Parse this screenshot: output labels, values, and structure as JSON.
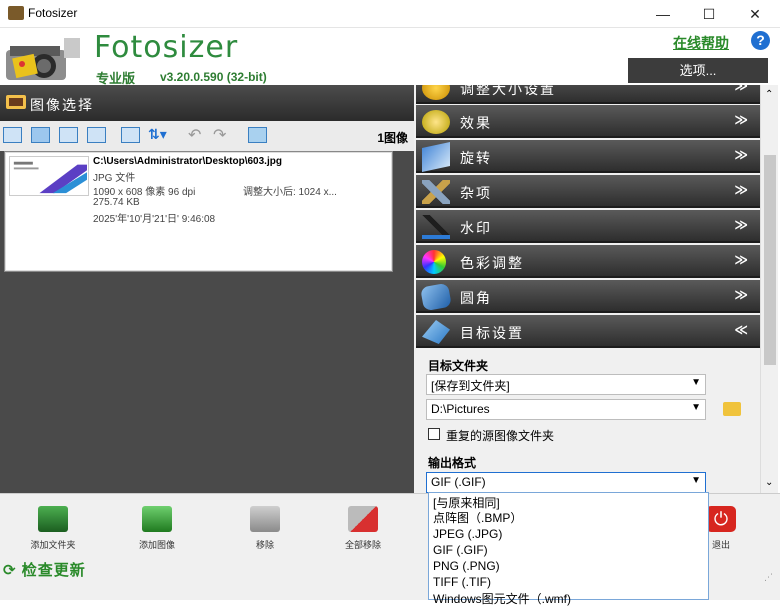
{
  "window": {
    "title": "Fotosizer",
    "minimize": "—",
    "maximize": "☐",
    "close": "✕"
  },
  "header": {
    "brand": "Fotosizer",
    "edition": "专业版",
    "version": "v3.20.0.590  (32-bit)",
    "help_link": "在线帮助",
    "help_icon": "?",
    "options_button": "选项..."
  },
  "left_panel": {
    "title": "图像选择",
    "count": "1图像",
    "file": {
      "path": "C:\\Users\\Administrator\\Desktop\\603.jpg",
      "type": "JPG 文件",
      "dims": "1090 x 608 像素 96 dpi",
      "resize_label": "调整大小后:  1024 x...",
      "size": "275.74 KB",
      "date": "2025'年'10'月'21'日' 9:46:08"
    }
  },
  "right_panel": {
    "sections": [
      {
        "label": "调整大小设置",
        "chev": "≫",
        "icon": "resize-icon"
      },
      {
        "label": "效果",
        "chev": "≫",
        "icon": "effects-icon"
      },
      {
        "label": "旋转",
        "chev": "≫",
        "icon": "rotate-icon"
      },
      {
        "label": "杂项",
        "chev": "≫",
        "icon": "tools-icon"
      },
      {
        "label": "水印",
        "chev": "≫",
        "icon": "watermark-icon"
      },
      {
        "label": "色彩调整",
        "chev": "≫",
        "icon": "color-wheel-icon"
      },
      {
        "label": "圆角",
        "chev": "≫",
        "icon": "rounded-corners-icon"
      },
      {
        "label": "目标设置",
        "chev": "≪",
        "icon": "target-icon"
      }
    ],
    "target_folder_label": "目标文件夹",
    "save_mode": "[保存到文件夹]",
    "folder_path": "D:\\Pictures",
    "checkbox_label": "重复的源图像文件夹",
    "output_format_label": "输出格式",
    "output_format_value": "GIF (.GIF)"
  },
  "dropdown_options": [
    "[与原来相同]",
    "点阵图（.BMP）",
    "JPEG (.JPG)",
    "GIF (.GIF)",
    "PNG (.PNG)",
    "TIFF (.TIF)",
    "Windows图元文件（.wmf)"
  ],
  "bottom": {
    "add_folder": "添加文件夹",
    "add_image": "添加图像",
    "remove": "移除",
    "remove_all": "全部移除",
    "exit": "退出",
    "check_update": "检查更新"
  },
  "colors": {
    "brand_green": "#2e8b3e",
    "dark_panel": "#4a4a4a",
    "accent_blue": "#1f6fd1"
  }
}
